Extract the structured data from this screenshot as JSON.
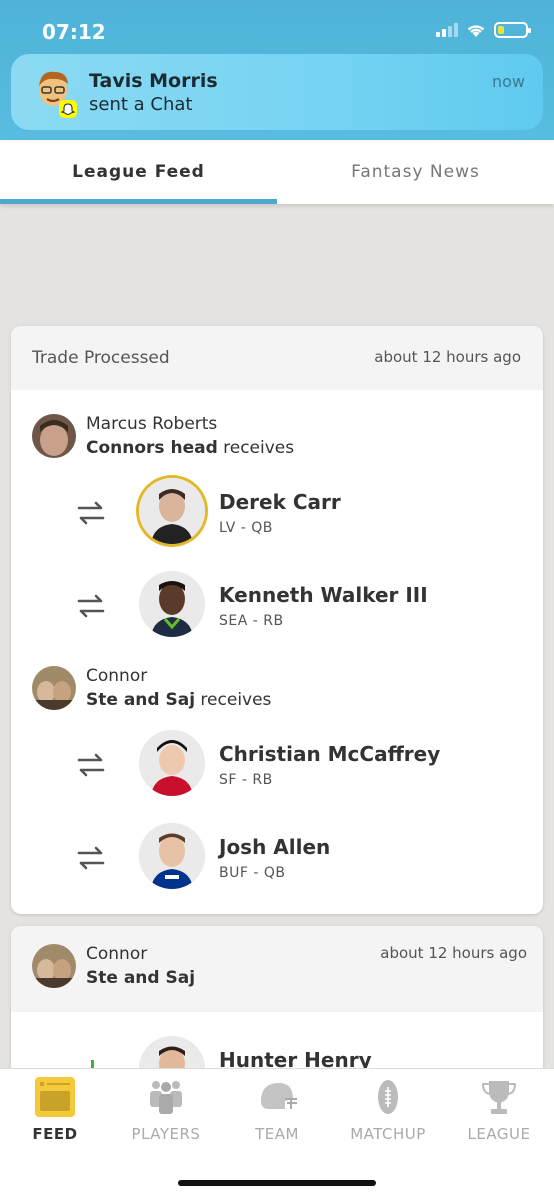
{
  "status": {
    "time": "07:12"
  },
  "notification": {
    "title": "Tavis Morris",
    "body": "sent a Chat",
    "time": "now"
  },
  "tabs": [
    {
      "label": "League Feed"
    },
    {
      "label": "Fantasy News"
    }
  ],
  "feed": [
    {
      "header": "Trade Processed",
      "time": "about 12 hours ago",
      "sides": [
        {
          "member": "Marcus Roberts",
          "team": "Connors head",
          "action": " receives",
          "players": [
            {
              "name": "Derek Carr",
              "meta": "LV - QB"
            },
            {
              "name": "Kenneth Walker III",
              "meta": "SEA - RB"
            }
          ]
        },
        {
          "member": "Connor",
          "team": "Ste and Saj",
          "action": " receives",
          "players": [
            {
              "name": "Christian McCaffrey",
              "meta": "SF - RB"
            },
            {
              "name": "Josh Allen",
              "meta": "BUF - QB"
            }
          ]
        }
      ]
    },
    {
      "member": "Connor",
      "team": "Ste and Saj",
      "time": "about 12 hours ago",
      "players": [
        {
          "name": "Hunter Henry"
        }
      ]
    }
  ],
  "nav": [
    {
      "label": "FEED",
      "icon": "feed-icon",
      "active": true
    },
    {
      "label": "PLAYERS",
      "icon": "players-icon"
    },
    {
      "label": "TEAM",
      "icon": "helmet-icon"
    },
    {
      "label": "MATCHUP",
      "icon": "football-icon"
    },
    {
      "label": "LEAGUE",
      "icon": "trophy-icon"
    }
  ],
  "colors": {
    "accent": "#4fa9cf",
    "feedIcon": "#f5c93a",
    "gold": "#e3b92b"
  }
}
